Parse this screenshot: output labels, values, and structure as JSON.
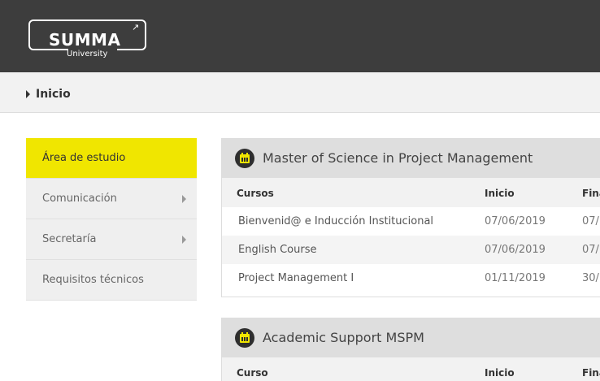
{
  "brand": {
    "name": "SUMMA",
    "sub": "University",
    "arrow": "↗"
  },
  "breadcrumb": {
    "label": "Inicio"
  },
  "sidebar": {
    "items": [
      {
        "label": "Área de estudio",
        "active": true
      },
      {
        "label": "Comunicación",
        "has_submenu": true
      },
      {
        "label": "Secretaría",
        "has_submenu": true
      },
      {
        "label": "Requisitos técnicos"
      }
    ]
  },
  "programs": [
    {
      "title": "Master of Science in Project Management",
      "headers": {
        "course": "Cursos",
        "start": "Inicio",
        "end": "Fina"
      },
      "rows": [
        {
          "course": "Bienvenid@ e Inducción Institucional",
          "start": "07/06/2019",
          "end": "07/"
        },
        {
          "course": "English Course",
          "start": "07/06/2019",
          "end": "07/"
        },
        {
          "course": "Project Management I",
          "start": "01/11/2019",
          "end": "30/"
        }
      ]
    },
    {
      "title": "Academic Support MSPM",
      "headers": {
        "course": "Curso",
        "start": "Inicio",
        "end": "Fina"
      }
    }
  ],
  "colors": {
    "topbar": "#3d3d3d",
    "accent": "#f0e600",
    "panel_header": "#dedede"
  },
  "icons": {
    "program": "calendar-icon",
    "breadcrumb": "caret-right-icon",
    "submenu": "caret-right-icon"
  }
}
